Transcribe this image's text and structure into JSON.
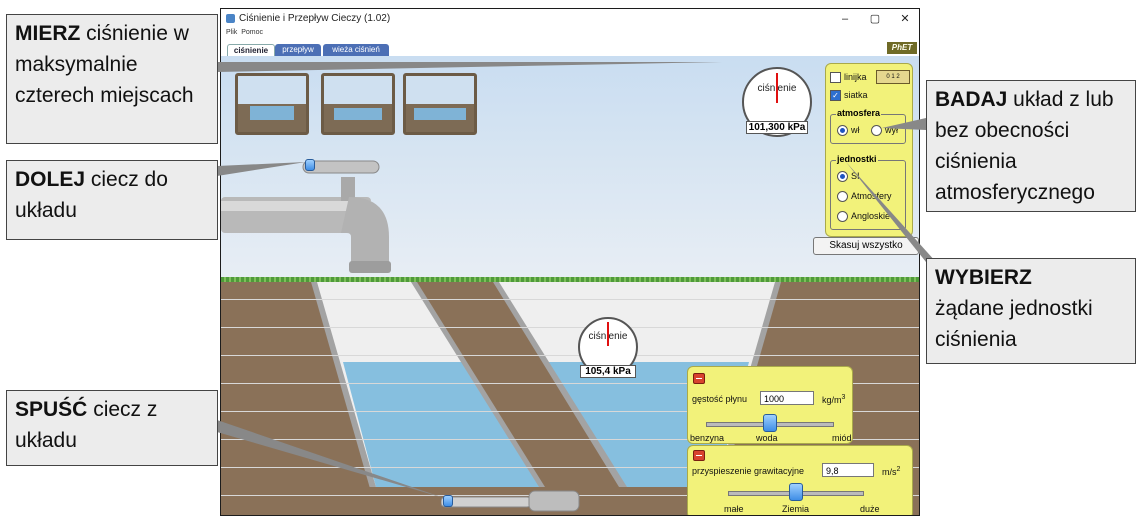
{
  "window": {
    "title": "Ciśnienie i Przepływ Cieczy (1.02)",
    "menu": [
      "Plik",
      "Pomoc"
    ],
    "tabs": [
      "ciśnienie",
      "przepływ",
      "wieża ciśnień"
    ],
    "active_tab": "ciśnienie",
    "logo": "PhET"
  },
  "gauges": {
    "top": {
      "label": "ciśnienie",
      "value": "101,300 kPa"
    },
    "water": {
      "label": "ciśnienie",
      "value": "105,4 kPa"
    }
  },
  "controls": {
    "ruler": {
      "label": "linijka",
      "checked": false,
      "scale_digits": "0 1 2"
    },
    "grid": {
      "label": "siatka",
      "checked": true
    },
    "atmosphere": {
      "title": "atmosfera",
      "on": "wł",
      "off": "wył",
      "selected": "wł"
    },
    "units": {
      "title": "jednostki",
      "options": [
        "SI",
        "Atmosfery",
        "Angloskie"
      ],
      "selected": "SI"
    },
    "reset": "Skasuj wszystko"
  },
  "density": {
    "label": "gęstość płynu",
    "value": "1000",
    "unit": "kg/m",
    "unit_sup": "3",
    "ticks": [
      "benzyna",
      "woda",
      "miód"
    ],
    "level": 0.5
  },
  "gravity": {
    "label": "przyspieszenie grawitacyjne",
    "value": "9,8",
    "unit": "m/s",
    "unit_sup": "2",
    "ticks": [
      "małe",
      "Ziemia",
      "duże"
    ],
    "level": 0.5
  },
  "callouts": {
    "measure": {
      "bold": "MIERZ",
      "text": " ciśnienie w maksymalnie czterech miejscach"
    },
    "fill": {
      "bold": "DOLEJ",
      "text": " ciecz do układu"
    },
    "drain": {
      "bold": "SPUŚĆ",
      "text": " ciecz z układu"
    },
    "explore": {
      "bold": "BADAJ",
      "text": " układ z lub bez obecności ciśnienia atmosferycznego"
    },
    "choose": {
      "bold": "WYBIERZ",
      "text": " żądane jednostki ciśnienia"
    }
  }
}
